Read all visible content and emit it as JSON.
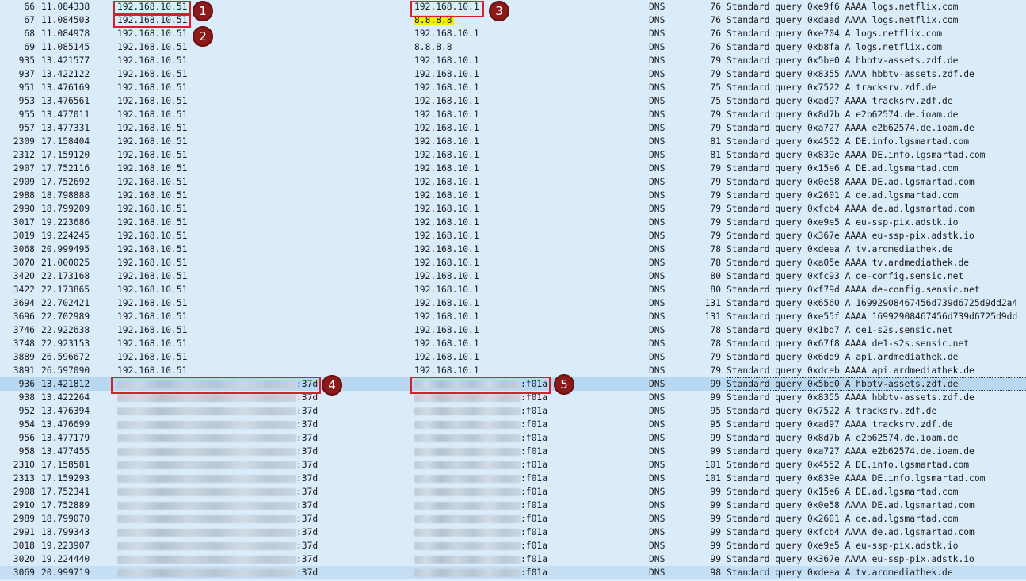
{
  "packets": [
    {
      "no": "66",
      "time": "11.084338",
      "src": "192.168.10.51",
      "dst": "192.168.10.1",
      "proto": "DNS",
      "len": "76",
      "info": "Standard query 0xe9f6 AAAA logs.netflix.com"
    },
    {
      "no": "67",
      "time": "11.084503",
      "src": "192.168.10.51",
      "dst": "8.8.8.8",
      "proto": "DNS",
      "len": "76",
      "info": "Standard query 0xdaad AAAA logs.netflix.com"
    },
    {
      "no": "68",
      "time": "11.084978",
      "src": "192.168.10.51",
      "dst": "192.168.10.1",
      "proto": "DNS",
      "len": "76",
      "info": "Standard query 0xe704 A logs.netflix.com"
    },
    {
      "no": "69",
      "time": "11.085145",
      "src": "192.168.10.51",
      "dst": "8.8.8.8",
      "proto": "DNS",
      "len": "76",
      "info": "Standard query 0xb8fa A logs.netflix.com"
    },
    {
      "no": "935",
      "time": "13.421577",
      "src": "192.168.10.51",
      "dst": "192.168.10.1",
      "proto": "DNS",
      "len": "79",
      "info": "Standard query 0x5be0 A hbbtv-assets.zdf.de"
    },
    {
      "no": "937",
      "time": "13.422122",
      "src": "192.168.10.51",
      "dst": "192.168.10.1",
      "proto": "DNS",
      "len": "79",
      "info": "Standard query 0x8355 AAAA hbbtv-assets.zdf.de"
    },
    {
      "no": "951",
      "time": "13.476169",
      "src": "192.168.10.51",
      "dst": "192.168.10.1",
      "proto": "DNS",
      "len": "75",
      "info": "Standard query 0x7522 A tracksrv.zdf.de"
    },
    {
      "no": "953",
      "time": "13.476561",
      "src": "192.168.10.51",
      "dst": "192.168.10.1",
      "proto": "DNS",
      "len": "75",
      "info": "Standard query 0xad97 AAAA tracksrv.zdf.de"
    },
    {
      "no": "955",
      "time": "13.477011",
      "src": "192.168.10.51",
      "dst": "192.168.10.1",
      "proto": "DNS",
      "len": "79",
      "info": "Standard query 0x8d7b A e2b62574.de.ioam.de"
    },
    {
      "no": "957",
      "time": "13.477331",
      "src": "192.168.10.51",
      "dst": "192.168.10.1",
      "proto": "DNS",
      "len": "79",
      "info": "Standard query 0xa727 AAAA e2b62574.de.ioam.de"
    },
    {
      "no": "2309",
      "time": "17.158404",
      "src": "192.168.10.51",
      "dst": "192.168.10.1",
      "proto": "DNS",
      "len": "81",
      "info": "Standard query 0x4552 A DE.info.lgsmartad.com"
    },
    {
      "no": "2312",
      "time": "17.159120",
      "src": "192.168.10.51",
      "dst": "192.168.10.1",
      "proto": "DNS",
      "len": "81",
      "info": "Standard query 0x839e AAAA DE.info.lgsmartad.com"
    },
    {
      "no": "2907",
      "time": "17.752116",
      "src": "192.168.10.51",
      "dst": "192.168.10.1",
      "proto": "DNS",
      "len": "79",
      "info": "Standard query 0x15e6 A DE.ad.lgsmartad.com"
    },
    {
      "no": "2909",
      "time": "17.752692",
      "src": "192.168.10.51",
      "dst": "192.168.10.1",
      "proto": "DNS",
      "len": "79",
      "info": "Standard query 0x0e58 AAAA DE.ad.lgsmartad.com"
    },
    {
      "no": "2988",
      "time": "18.798888",
      "src": "192.168.10.51",
      "dst": "192.168.10.1",
      "proto": "DNS",
      "len": "79",
      "info": "Standard query 0x2601 A de.ad.lgsmartad.com"
    },
    {
      "no": "2990",
      "time": "18.799209",
      "src": "192.168.10.51",
      "dst": "192.168.10.1",
      "proto": "DNS",
      "len": "79",
      "info": "Standard query 0xfcb4 AAAA de.ad.lgsmartad.com"
    },
    {
      "no": "3017",
      "time": "19.223686",
      "src": "192.168.10.51",
      "dst": "192.168.10.1",
      "proto": "DNS",
      "len": "79",
      "info": "Standard query 0xe9e5 A eu-ssp-pix.adstk.io"
    },
    {
      "no": "3019",
      "time": "19.224245",
      "src": "192.168.10.51",
      "dst": "192.168.10.1",
      "proto": "DNS",
      "len": "79",
      "info": "Standard query 0x367e AAAA eu-ssp-pix.adstk.io"
    },
    {
      "no": "3068",
      "time": "20.999495",
      "src": "192.168.10.51",
      "dst": "192.168.10.1",
      "proto": "DNS",
      "len": "78",
      "info": "Standard query 0xdeea A tv.ardmediathek.de"
    },
    {
      "no": "3070",
      "time": "21.000025",
      "src": "192.168.10.51",
      "dst": "192.168.10.1",
      "proto": "DNS",
      "len": "78",
      "info": "Standard query 0xa05e AAAA tv.ardmediathek.de"
    },
    {
      "no": "3420",
      "time": "22.173168",
      "src": "192.168.10.51",
      "dst": "192.168.10.1",
      "proto": "DNS",
      "len": "80",
      "info": "Standard query 0xfc93 A de-config.sensic.net"
    },
    {
      "no": "3422",
      "time": "22.173865",
      "src": "192.168.10.51",
      "dst": "192.168.10.1",
      "proto": "DNS",
      "len": "80",
      "info": "Standard query 0xf79d AAAA de-config.sensic.net"
    },
    {
      "no": "3694",
      "time": "22.702421",
      "src": "192.168.10.51",
      "dst": "192.168.10.1",
      "proto": "DNS",
      "len": "131",
      "info": "Standard query 0x6560 A 16992908467456d739d6725d9dd2a4"
    },
    {
      "no": "3696",
      "time": "22.702989",
      "src": "192.168.10.51",
      "dst": "192.168.10.1",
      "proto": "DNS",
      "len": "131",
      "info": "Standard query 0xe55f AAAA 16992908467456d739d6725d9dd"
    },
    {
      "no": "3746",
      "time": "22.922638",
      "src": "192.168.10.51",
      "dst": "192.168.10.1",
      "proto": "DNS",
      "len": "78",
      "info": "Standard query 0x1bd7 A de1-s2s.sensic.net"
    },
    {
      "no": "3748",
      "time": "22.923153",
      "src": "192.168.10.51",
      "dst": "192.168.10.1",
      "proto": "DNS",
      "len": "78",
      "info": "Standard query 0x67f8 AAAA de1-s2s.sensic.net"
    },
    {
      "no": "3889",
      "time": "26.596672",
      "src": "192.168.10.51",
      "dst": "192.168.10.1",
      "proto": "DNS",
      "len": "79",
      "info": "Standard query 0x6dd9 A api.ardmediathek.de"
    },
    {
      "no": "3891",
      "time": "26.597090",
      "src": "192.168.10.51",
      "dst": "192.168.10.1",
      "proto": "DNS",
      "len": "79",
      "info": "Standard query 0xdceb AAAA api.ardmediathek.de"
    },
    {
      "no": "936",
      "time": "13.421812",
      "src": ":37d",
      "dst": ":f01a",
      "proto": "DNS",
      "len": "99",
      "info": "Standard query 0x5be0 A hbbtv-assets.zdf.de"
    },
    {
      "no": "938",
      "time": "13.422264",
      "src": ":37d",
      "dst": ":f01a",
      "proto": "DNS",
      "len": "99",
      "info": "Standard query 0x8355 AAAA hbbtv-assets.zdf.de"
    },
    {
      "no": "952",
      "time": "13.476394",
      "src": ":37d",
      "dst": ":f01a",
      "proto": "DNS",
      "len": "95",
      "info": "Standard query 0x7522 A tracksrv.zdf.de"
    },
    {
      "no": "954",
      "time": "13.476699",
      "src": ":37d",
      "dst": ":f01a",
      "proto": "DNS",
      "len": "95",
      "info": "Standard query 0xad97 AAAA tracksrv.zdf.de"
    },
    {
      "no": "956",
      "time": "13.477179",
      "src": ":37d",
      "dst": ":f01a",
      "proto": "DNS",
      "len": "99",
      "info": "Standard query 0x8d7b A e2b62574.de.ioam.de"
    },
    {
      "no": "958",
      "time": "13.477455",
      "src": ":37d",
      "dst": ":f01a",
      "proto": "DNS",
      "len": "99",
      "info": "Standard query 0xa727 AAAA e2b62574.de.ioam.de"
    },
    {
      "no": "2310",
      "time": "17.158581",
      "src": ":37d",
      "dst": ":f01a",
      "proto": "DNS",
      "len": "101",
      "info": "Standard query 0x4552 A DE.info.lgsmartad.com"
    },
    {
      "no": "2313",
      "time": "17.159293",
      "src": ":37d",
      "dst": ":f01a",
      "proto": "DNS",
      "len": "101",
      "info": "Standard query 0x839e AAAA DE.info.lgsmartad.com"
    },
    {
      "no": "2908",
      "time": "17.752341",
      "src": ":37d",
      "dst": ":f01a",
      "proto": "DNS",
      "len": "99",
      "info": "Standard query 0x15e6 A DE.ad.lgsmartad.com"
    },
    {
      "no": "2910",
      "time": "17.752889",
      "src": ":37d",
      "dst": ":f01a",
      "proto": "DNS",
      "len": "99",
      "info": "Standard query 0x0e58 AAAA DE.ad.lgsmartad.com"
    },
    {
      "no": "2989",
      "time": "18.799070",
      "src": ":37d",
      "dst": ":f01a",
      "proto": "DNS",
      "len": "99",
      "info": "Standard query 0x2601 A de.ad.lgsmartad.com"
    },
    {
      "no": "2991",
      "time": "18.799343",
      "src": ":37d",
      "dst": ":f01a",
      "proto": "DNS",
      "len": "99",
      "info": "Standard query 0xfcb4 AAAA de.ad.lgsmartad.com"
    },
    {
      "no": "3018",
      "time": "19.223907",
      "src": ":37d",
      "dst": ":f01a",
      "proto": "DNS",
      "len": "99",
      "info": "Standard query 0xe9e5 A eu-ssp-pix.adstk.io"
    },
    {
      "no": "3020",
      "time": "19.224440",
      "src": ":37d",
      "dst": ":f01a",
      "proto": "DNS",
      "len": "99",
      "info": "Standard query 0x367e AAAA eu-ssp-pix.adstk.io"
    },
    {
      "no": "3069",
      "time": "20.999719",
      "src": ":37d",
      "dst": ":f01a",
      "proto": "DNS",
      "len": "98",
      "info": "Standard query 0xdeea A tv.ardmediathek.de"
    }
  ],
  "annotations": [
    "1",
    "2",
    "3",
    "4",
    "5"
  ],
  "colors": {
    "row_bg": "#daebfa",
    "selected_row_bg": "#b8d8f2",
    "annotation_box": "#d6202b",
    "annotation_badge": "#8b1a1a",
    "dns_highlight": "#f0f000"
  }
}
